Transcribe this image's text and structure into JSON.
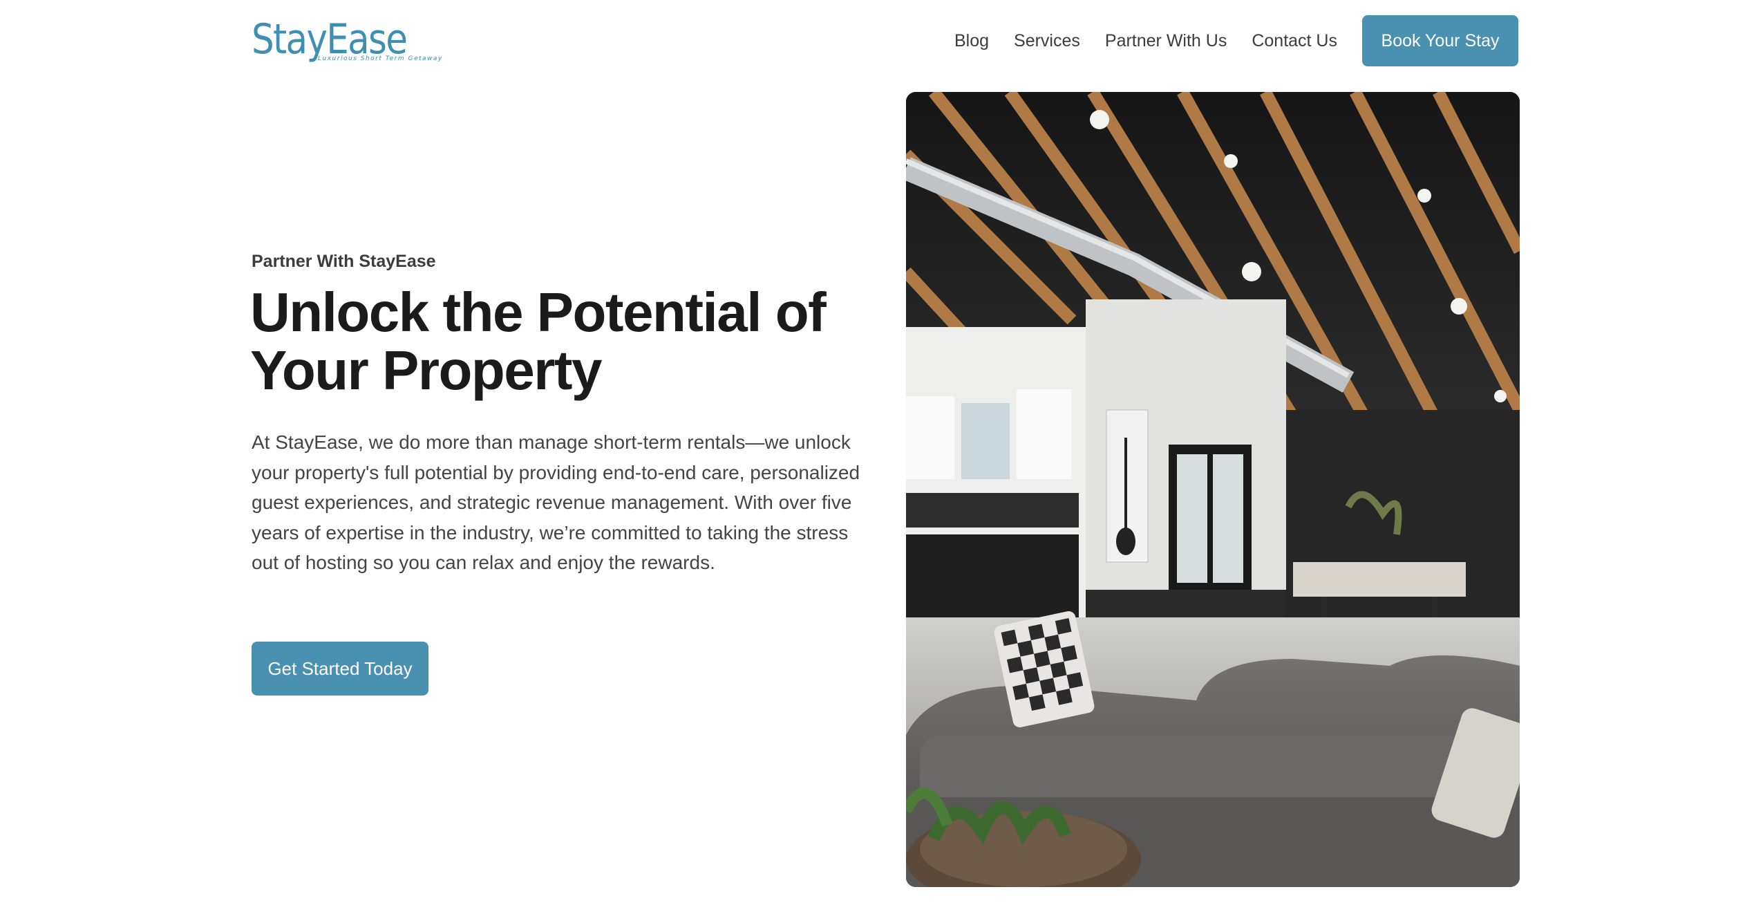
{
  "brand": {
    "name": "StayEase",
    "tagline": "Luxurious Short Term Getaway",
    "color": "#3e8fb2"
  },
  "nav": {
    "links": [
      "Blog",
      "Services",
      "Partner With Us",
      "Contact Us"
    ],
    "cta_label": "Book Your Stay"
  },
  "hero": {
    "eyebrow": "Partner With StayEase",
    "headline": "Unlock the Potential of Your Property",
    "body": "At StayEase, we do more than manage short-term rentals—we unlock your property's full potential by providing end-to-end care, personalized guest experiences, and strategic revenue management. With over five years of expertise in the industry, we’re committed to taking the stress out of hosting so you can relax and enjoy the rewards.",
    "cta_label": "Get Started Today",
    "image_subject": "modern-living-room-photo"
  },
  "colors": {
    "accent": "#4a90b0",
    "heading": "#1b1b1b",
    "body": "#444444"
  }
}
